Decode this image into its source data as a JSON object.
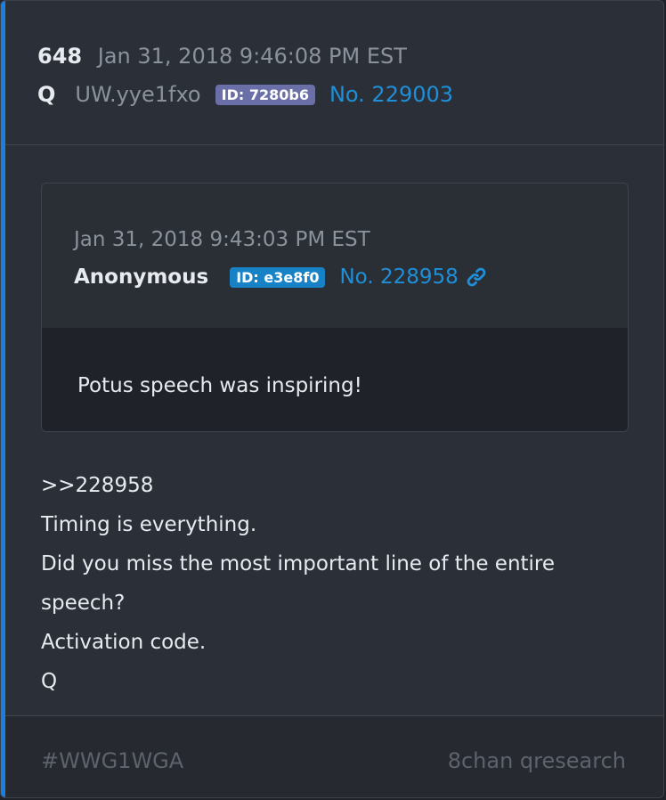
{
  "post": {
    "count": "648",
    "date": "Jan 31, 2018 9:46:08 PM EST",
    "author": "Q",
    "tripcode": "UW.yye1fxo",
    "id_badge": "ID: 7280b6",
    "post_number": "No. 229003"
  },
  "quoted": {
    "date": "Jan 31, 2018 9:43:03 PM EST",
    "author": "Anonymous",
    "id_badge": "ID: e3e8f0",
    "post_number": "No. 228958",
    "text": "Potus speech was inspiring!"
  },
  "body_lines": [
    ">>228958",
    "Timing is everything.",
    "Did you miss the most important line of the entire",
    "speech?",
    "Activation code.",
    "Q"
  ],
  "footer": {
    "hashtag": "#WWG1WGA",
    "source": "8chan qresearch"
  },
  "colors": {
    "accent": "#1a7fe0",
    "link": "#1e8fd8",
    "badge_purple": "#6a6fa8",
    "badge_blue": "#1782c6"
  },
  "icons": {
    "link": "link-icon"
  }
}
